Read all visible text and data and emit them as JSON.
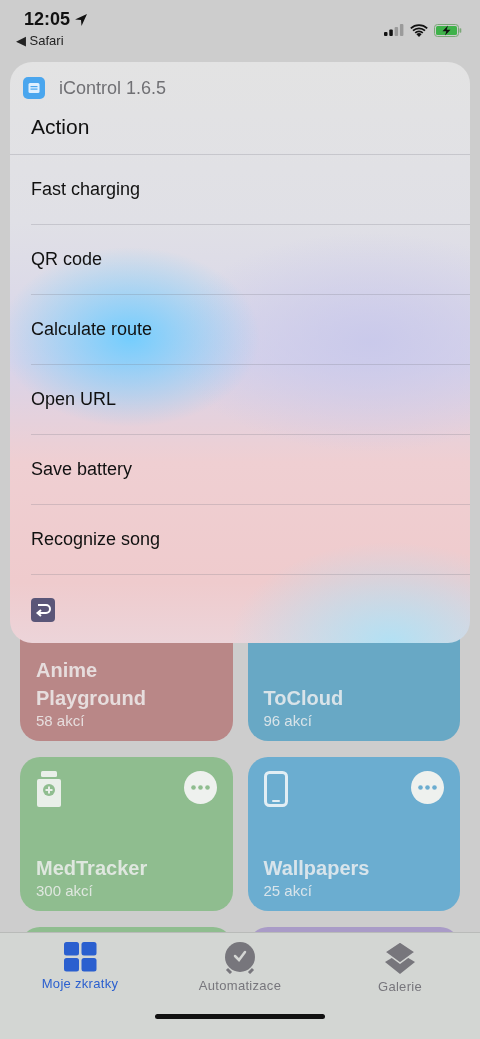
{
  "status_bar": {
    "time": "12:05",
    "back_label": "◀ Safari"
  },
  "sheet": {
    "app_name": "iControl 1.6.5",
    "title": "Action",
    "items": [
      {
        "label": "Fast charging"
      },
      {
        "label": "QR code"
      },
      {
        "label": "Calculate route"
      },
      {
        "label": "Open URL"
      },
      {
        "label": "Save battery"
      },
      {
        "label": "Recognize song"
      }
    ]
  },
  "shortcuts": [
    {
      "name": "Anime Playground",
      "count": "58 akcí",
      "color": "#b98787",
      "kind": "plain"
    },
    {
      "name": "ToCloud",
      "count": "96 akcí",
      "color": "#68a8c5",
      "kind": "plain"
    },
    {
      "name": "MedTracker",
      "count": "300 akcí",
      "color": "#8fbd8f",
      "kind": "bottle"
    },
    {
      "name": "Wallpapers",
      "count": "25 akcí",
      "color": "#6badd0",
      "kind": "phone"
    },
    {
      "color": "#8fbd8f",
      "kind": "plain"
    },
    {
      "color": "#a99bc7",
      "kind": "plain"
    }
  ],
  "tabs": [
    {
      "label": "Moje zkratky",
      "selected": true
    },
    {
      "label": "Automatizace",
      "selected": false
    },
    {
      "label": "Galerie",
      "selected": false
    }
  ]
}
